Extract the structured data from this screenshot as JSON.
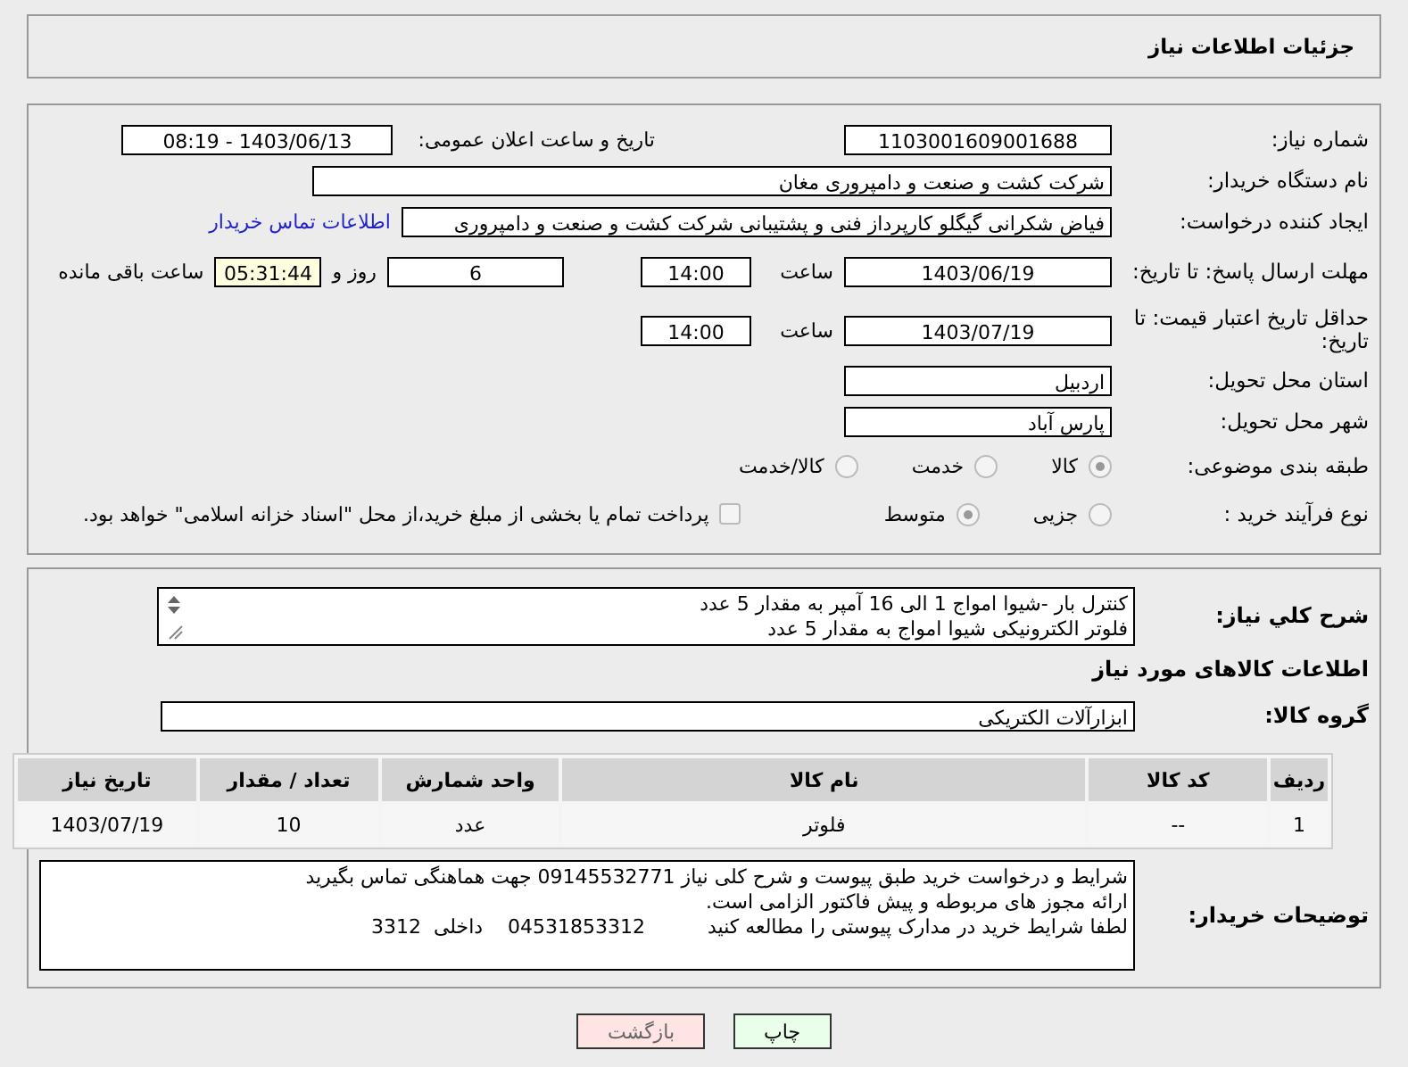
{
  "header": {
    "title": "جزئیات اطلاعات نیاز"
  },
  "need_number": {
    "label": "شماره نیاز:",
    "value": "1103001609001688"
  },
  "announce": {
    "label": "تاریخ و ساعت اعلان عمومی:",
    "value": "1403/06/13 - 08:19"
  },
  "buyer": {
    "label": "نام دستگاه خریدار:",
    "value": "شرکت کشت و صنعت و دامپروری مغان"
  },
  "requester": {
    "label": "ایجاد کننده درخواست:",
    "value": "فیاض شکرانی گیگلو کارپرداز فنی و پشتیبانی شرکت کشت و صنعت و دامپروری",
    "link": "اطلاعات تماس خریدار"
  },
  "deadline": {
    "label": "مهلت ارسال پاسخ: تا تاریخ:",
    "date": "1403/06/19",
    "time_label": "ساعت",
    "time": "14:00",
    "days": "6",
    "days_label": "روز و",
    "remaining": "05:31:44",
    "remaining_label": "ساعت باقی مانده"
  },
  "validity": {
    "label": "حداقل تاریخ اعتبار قیمت: تا تاریخ:",
    "date": "1403/07/19",
    "time_label": "ساعت",
    "time": "14:00"
  },
  "province": {
    "label": "استان محل تحویل:",
    "value": "اردبیل"
  },
  "city": {
    "label": "شهر محل تحویل:",
    "value": "پارس آباد"
  },
  "category": {
    "label": "طبقه بندی موضوعی:",
    "options": [
      {
        "label": "کالا",
        "selected": true
      },
      {
        "label": "خدمت",
        "selected": false
      },
      {
        "label": "کالا/خدمت",
        "selected": false
      }
    ]
  },
  "process": {
    "label": "نوع فرآیند خرید :",
    "options": [
      {
        "label": "جزیی",
        "selected": false
      },
      {
        "label": "متوسط",
        "selected": true
      }
    ],
    "payment": {
      "label": "پرداخت تمام یا بخشی از مبلغ خرید،از محل \"اسناد خزانه اسلامی\" خواهد بود.",
      "checked": false
    }
  },
  "description": {
    "label": "شرح کلي نياز:",
    "lines": [
      "کنترل بار -شیوا امواج 1 الی 16 آمپر به مقدار 5 عدد",
      "فلوتر الکترونیکی شیوا امواج  به مقدار  5 عدد"
    ]
  },
  "goods_heading": "اطلاعات کالاهای مورد نیاز",
  "goods_group": {
    "label": "گروه کالا:",
    "value": "ابزارآلات الکتریکی"
  },
  "table": {
    "columns": [
      "ردیف",
      "کد کالا",
      "نام کالا",
      "واحد شمارش",
      "تعداد / مقدار",
      "تاریخ نیاز"
    ],
    "rows": [
      [
        "1",
        "--",
        "فلوتر",
        "عدد",
        "10",
        "1403/07/19"
      ]
    ]
  },
  "buyer_notes": {
    "label": "توضیحات خریدار:",
    "lines": [
      "شرایط و درخواست خرید طبق پیوست و شرح کلی نیاز 09145532771 جهت هماهنگی تماس بگیرید",
      "ارائه مجوز های مربوطه و پیش فاکتور الزامی است.",
      "لطفا شرایط خرید در مدارک پیوستی را مطالعه کنید          04531853312    داخلی  3312"
    ]
  },
  "buttons": [
    {
      "label": "چاپ",
      "kind": "print"
    },
    {
      "label": "بازگشت",
      "kind": "back"
    }
  ]
}
